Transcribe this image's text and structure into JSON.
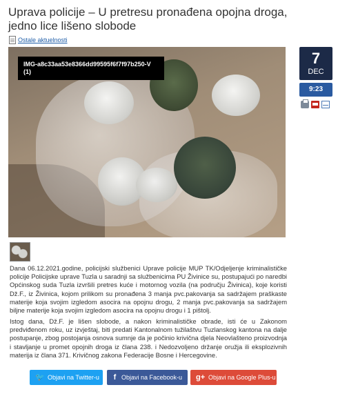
{
  "article": {
    "title": "Uprava policije – U pretresu pronađena opojna droga, jedno lice lišeno slobode",
    "breadcrumb_link": "Ostale aktuelnosti",
    "image_label": "IMG-a8c33aa53e8366dd99595f6f7f97b250-V (1)",
    "date_day": "7",
    "date_month": "DEC",
    "time": "9:23",
    "paragraph1": "Dana 06.12.2021.godine, policijski službenici Uprave policije MUP TK/Odjeljenje kriminalističke policije Policijske uprave Tuzla u saradnji sa službenicima PU Živinice su, postupajući po naredbi Općinskog suda Tuzla izvršili pretres kuće i motornog vozila (na području Živinica), koje koristi Dž.F., iz Živinica, kojom prilikom su pronađena 3 manja pvc.pakovanja sa sadržajem praškaste materije koja svojim izgledom asocira na opojnu drogu, 2 manja pvc.pakovanja sa sadržajem biljne materije koja svojim izgledom asocira na opojnu drogu i 1 pištolj.",
    "paragraph2": "Istog dana, Dž.F. je lišen slobode, a nakon kriminalističke obrade, isti će u Zakonom predviđenom roku, uz izvještaj, biti predati Kantonalnom tužilaštvu Tuzlanskog kantona na dalje postupanje, zbog postojanja osnova sumnje da je počinio krivična djela Neovlašteno proizvodnja i stavljanje u promet opojnih droga iz člana 238. i Nedozvoljeno držanje oružja ili eksplozivnih materija iz člana 371. Krivičnog zakona Federacije Bosne i Hercegovine."
  },
  "share": {
    "twitter": "Objavi na Twitter-u",
    "facebook": "Objavi na Facebook-u",
    "google": "Objavi na Google Plus-u"
  },
  "colors": {
    "date_bg": "#1c2a47",
    "time_bg": "#2a5aa0",
    "twitter": "#1da1f2",
    "facebook": "#3b5998",
    "google": "#dd4b39"
  }
}
